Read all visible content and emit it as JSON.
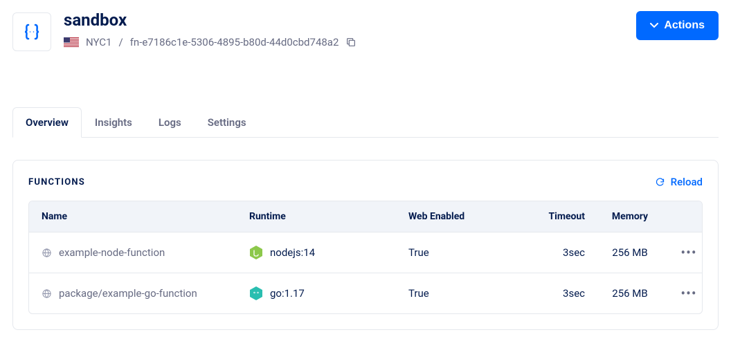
{
  "header": {
    "title": "sandbox",
    "region": "NYC1",
    "separator": "/",
    "function_id": "fn-e7186c1e-5306-4895-b80d-44d0cbd748a2",
    "actions_label": "Actions"
  },
  "tabs": [
    {
      "label": "Overview",
      "active": true
    },
    {
      "label": "Insights",
      "active": false
    },
    {
      "label": "Logs",
      "active": false
    },
    {
      "label": "Settings",
      "active": false
    }
  ],
  "panel": {
    "title": "FUNCTIONS",
    "reload_label": "Reload",
    "columns": {
      "name": "Name",
      "runtime": "Runtime",
      "web_enabled": "Web Enabled",
      "timeout": "Timeout",
      "memory": "Memory"
    },
    "rows": [
      {
        "name": "example-node-function",
        "runtime": "nodejs:14",
        "runtime_icon": "nodejs",
        "runtime_color": "#8cc84b",
        "web_enabled": "True",
        "timeout": "3sec",
        "memory": "256 MB"
      },
      {
        "name": "package/example-go-function",
        "runtime": "go:1.17",
        "runtime_icon": "go",
        "runtime_color": "#29beb0",
        "web_enabled": "True",
        "timeout": "3sec",
        "memory": "256 MB"
      }
    ]
  }
}
